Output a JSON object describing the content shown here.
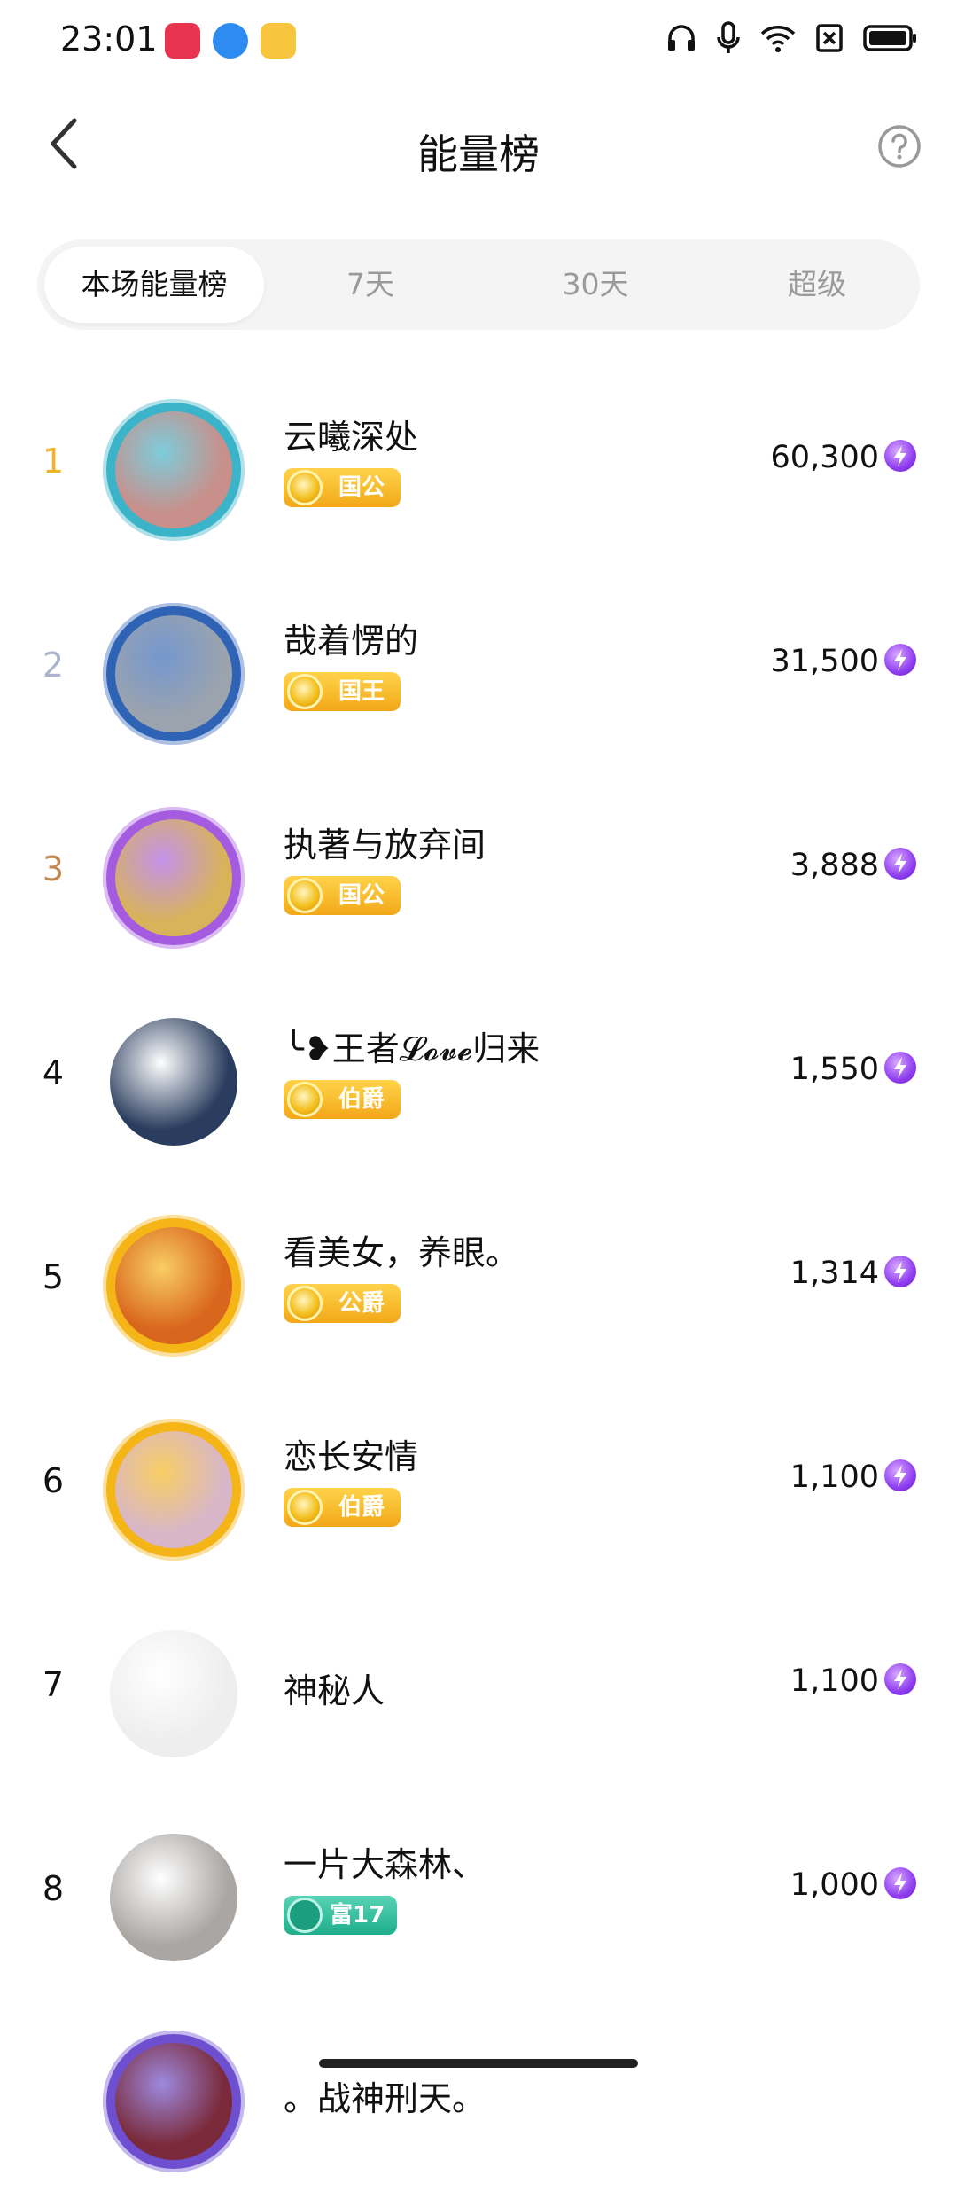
{
  "status": {
    "time": "23:01"
  },
  "header": {
    "title": "能量榜"
  },
  "tabs": [
    "本场能量榜",
    "7天",
    "30天",
    "超级"
  ],
  "rows": [
    {
      "rank": "1",
      "rank_color": "#f0b429",
      "name": "云曦深处",
      "badge": "国公",
      "badge_type": "gold",
      "score": "60,300",
      "avatar_color": "#c98f8a",
      "frame_color": "#3bb3c9"
    },
    {
      "rank": "2",
      "rank_color": "#aab4cc",
      "name": "哉着愣的",
      "badge": "国王",
      "badge_type": "gold",
      "score": "31,500",
      "avatar_color": "#9aa3ae",
      "frame_color": "#2f63b6"
    },
    {
      "rank": "3",
      "rank_color": "#c08a52",
      "name": "执著与放弃间",
      "badge": "国公",
      "badge_type": "gold",
      "score": "3,888",
      "avatar_color": "#d8b35a",
      "frame_color": "#a55be0"
    },
    {
      "rank": "4",
      "rank_color": "#111111",
      "name": "╰❥王者𝓛𝓸𝓿𝓮归来",
      "badge": "伯爵",
      "badge_type": "gold",
      "score": "1,550",
      "avatar_color": "#2a3d5e",
      "frame_color": "#ffffff"
    },
    {
      "rank": "5",
      "rank_color": "#111111",
      "name": "看美女，养眼。",
      "badge": "公爵",
      "badge_type": "gold",
      "score": "1,314",
      "avatar_color": "#d9661d",
      "frame_color": "#f5b516"
    },
    {
      "rank": "6",
      "rank_color": "#111111",
      "name": "恋长安情",
      "badge": "伯爵",
      "badge_type": "gold",
      "score": "1,100",
      "avatar_color": "#d8b6c8",
      "frame_color": "#f5b516"
    },
    {
      "rank": "7",
      "rank_color": "#111111",
      "name": "神秘人",
      "badge": "",
      "badge_type": "none",
      "score": "1,100",
      "avatar_color": "#eeeeee",
      "frame_color": "#ffffff"
    },
    {
      "rank": "8",
      "rank_color": "#111111",
      "name": "一片大森林、",
      "badge": "富17",
      "badge_type": "green",
      "score": "1,000",
      "avatar_color": "#a9a6a3",
      "frame_color": "#ffffff"
    },
    {
      "rank": "",
      "rank_color": "#111111",
      "name": "。战神刑天。",
      "badge": "",
      "badge_type": "none",
      "score": "",
      "avatar_color": "#7a2a3a",
      "frame_color": "#6d4fd0"
    }
  ]
}
